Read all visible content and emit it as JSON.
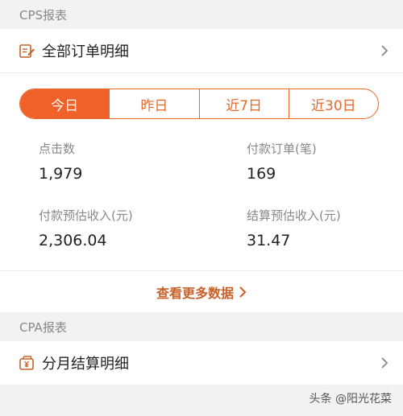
{
  "cps": {
    "section_title": "CPS报表",
    "all_orders_label": "全部订单明细",
    "tabs": [
      {
        "label": "今日",
        "active": true
      },
      {
        "label": "昨日",
        "active": false
      },
      {
        "label": "近7日",
        "active": false
      },
      {
        "label": "近30日",
        "active": false
      }
    ],
    "stats": [
      {
        "label": "点击数",
        "value": "1,979"
      },
      {
        "label": "付款订单(笔)",
        "value": "169"
      },
      {
        "label": "付款预估收入(元)",
        "value": "2,306.04"
      },
      {
        "label": "结算预估收入(元)",
        "value": "31.47"
      }
    ],
    "more_label": "查看更多数据"
  },
  "cpa": {
    "section_title": "CPA报表",
    "monthly_label": "分月结算明细"
  },
  "watermark": "头条 @阳光花菜",
  "colors": {
    "accent": "#f0612a",
    "link": "#c8612a",
    "background": "#f2f2f2"
  }
}
